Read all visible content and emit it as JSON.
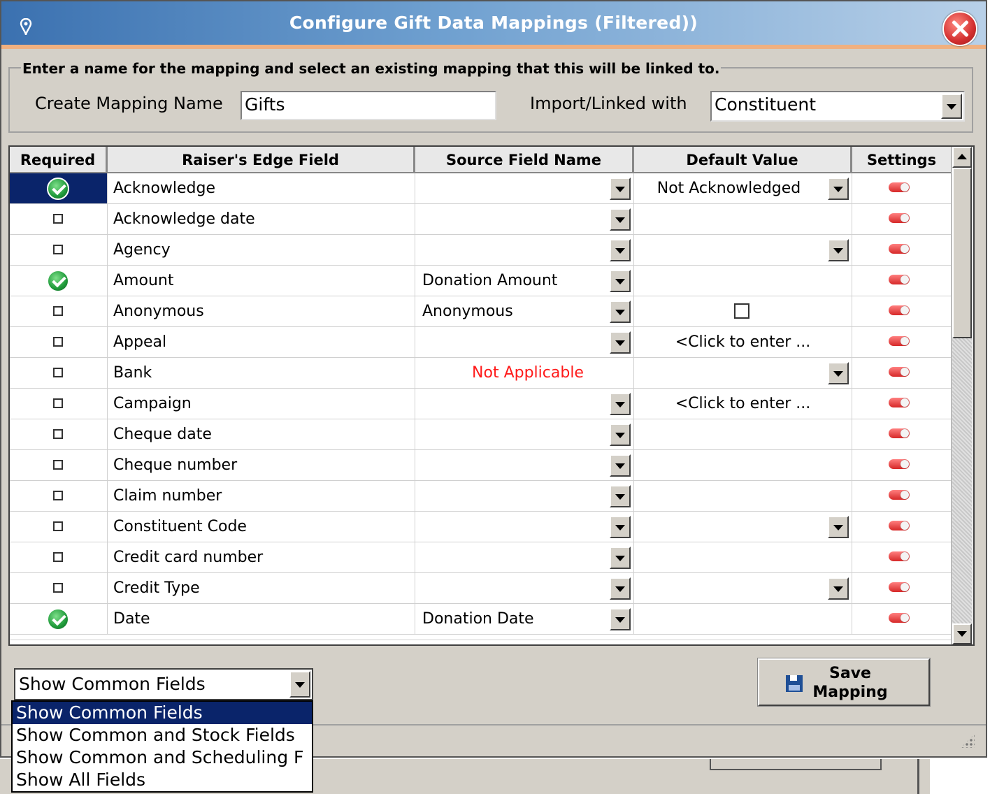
{
  "window": {
    "title": "Configure Gift Data Mappings (Filtered))"
  },
  "group": {
    "legend": "Enter a name for the mapping and select an existing mapping that this will be linked to.",
    "mapping_name_label": "Create Mapping Name",
    "mapping_name_value": "Gifts",
    "linked_label": "Import/Linked with",
    "linked_value": "Constituent"
  },
  "grid": {
    "headers": [
      "Required",
      "Raiser's Edge Field",
      "Source Field Name",
      "Default Value",
      "Settings"
    ],
    "rows": [
      {
        "field": "Acknowledge",
        "required": true,
        "selected": true,
        "source": "",
        "default": "Not Acknowledged",
        "default_type": "dropdown"
      },
      {
        "field": "Acknowledge date",
        "required": false,
        "source": "",
        "default": "",
        "default_type": "none"
      },
      {
        "field": "Agency",
        "required": false,
        "source": "",
        "default": "",
        "default_type": "dropdown"
      },
      {
        "field": "Amount",
        "required": true,
        "source": "Donation Amount",
        "default": "",
        "default_type": "none"
      },
      {
        "field": "Anonymous",
        "required": false,
        "source": "Anonymous",
        "default": "",
        "default_type": "checkbox"
      },
      {
        "field": "Appeal",
        "required": false,
        "source": "",
        "default": "<Click to enter ...",
        "default_type": "click"
      },
      {
        "field": "Bank",
        "required": false,
        "source": "Not Applicable",
        "source_na": true,
        "default": "",
        "default_type": "dropdown"
      },
      {
        "field": "Campaign",
        "required": false,
        "source": "",
        "default": "<Click to enter ...",
        "default_type": "click"
      },
      {
        "field": "Cheque date",
        "required": false,
        "source": "",
        "default": "",
        "default_type": "none"
      },
      {
        "field": "Cheque number",
        "required": false,
        "source": "",
        "default": "",
        "default_type": "none"
      },
      {
        "field": "Claim number",
        "required": false,
        "source": "",
        "default": "",
        "default_type": "none"
      },
      {
        "field": "Constituent Code",
        "required": false,
        "source": "",
        "default": "",
        "default_type": "dropdown"
      },
      {
        "field": "Credit card number",
        "required": false,
        "source": "",
        "default": "",
        "default_type": "none"
      },
      {
        "field": "Credit Type",
        "required": false,
        "source": "",
        "default": "",
        "default_type": "dropdown"
      },
      {
        "field": "Date",
        "required": true,
        "source": "Donation Date",
        "default": "",
        "default_type": "none"
      }
    ]
  },
  "filter": {
    "selected": "Show Common Fields",
    "options": [
      "Show Common Fields",
      "Show Common and Stock Fields",
      "Show Common and Scheduling F",
      "Show All Fields"
    ]
  },
  "save_button": {
    "label": "Save\nMapping"
  },
  "colors": {
    "title_gradient_start": "#3b71b0",
    "selection": "#0a246a",
    "not_applicable": "#ff1a1a",
    "toggle": "#d62828"
  }
}
